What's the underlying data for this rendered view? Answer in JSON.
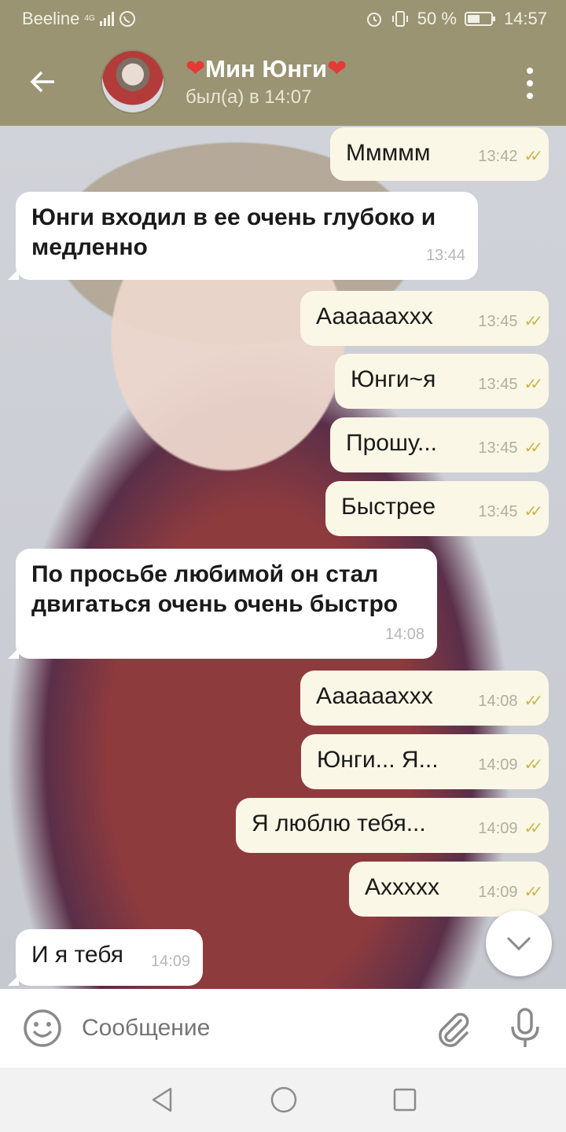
{
  "status_bar": {
    "carrier": "Beeline",
    "network": "4G",
    "battery": "50 %",
    "time": "14:57"
  },
  "header": {
    "contact_name": "Мин Юнги",
    "last_seen": "был(а) в 14:07"
  },
  "messages": [
    {
      "dir": "out",
      "text": "Ммммм",
      "time": "13:42"
    },
    {
      "dir": "in",
      "text": "Юнги входил в ее очень глубоко и медленно",
      "time": "13:44"
    },
    {
      "dir": "out",
      "text": "Ааааааххх",
      "time": "13:45"
    },
    {
      "dir": "out",
      "text": "Юнги~я",
      "time": "13:45"
    },
    {
      "dir": "out",
      "text": "Прошу...",
      "time": "13:45"
    },
    {
      "dir": "out",
      "text": "Быстрее",
      "time": "13:45"
    },
    {
      "dir": "in",
      "text": "По просьбе любимой он стал двигаться очень очень быстро",
      "time": "14:08"
    },
    {
      "dir": "out",
      "text": "Ааааааххх",
      "time": "14:08"
    },
    {
      "dir": "out",
      "text": "Юнги... Я...",
      "time": "14:09"
    },
    {
      "dir": "out",
      "text": "Я люблю тебя...",
      "time": "14:09"
    },
    {
      "dir": "out",
      "text": "Аххххх",
      "time": "14:09"
    },
    {
      "dir": "in",
      "text": "И я тебя",
      "time": "14:09"
    }
  ],
  "composer": {
    "placeholder": "Сообщение"
  },
  "icons": {
    "back": "arrow-left-icon",
    "menu": "more-vertical-icon",
    "emoji": "smiley-icon",
    "attach": "paperclip-icon",
    "mic": "microphone-icon",
    "scroll_down": "chevron-down-icon",
    "read_status": "double-check-icon",
    "nav": [
      "back-triangle-icon",
      "home-circle-icon",
      "recents-square-icon"
    ]
  },
  "colors": {
    "header_bg": "#9a9473",
    "outgoing_bubble": "#fbf7e6",
    "incoming_bubble": "#ffffff",
    "read_ticks": "#c9b64f"
  }
}
